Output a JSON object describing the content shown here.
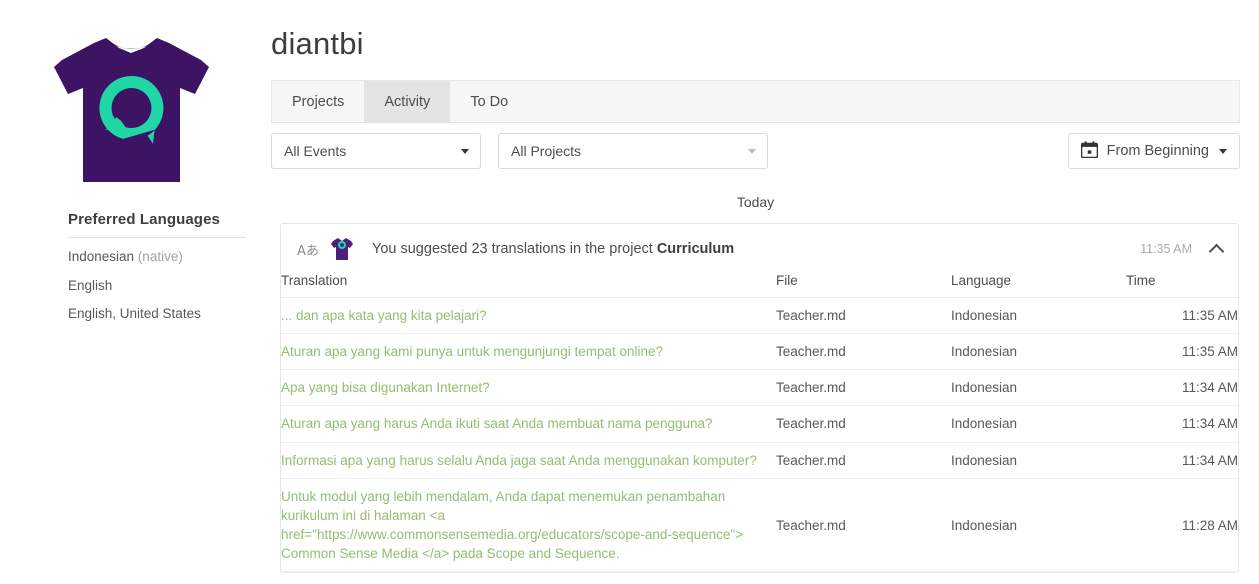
{
  "colors": {
    "shirt_purple": "#3d1464",
    "shirt_logo_teal": "#21d6a6",
    "link_green": "#93bd73",
    "tab_active_bg": "#e4e4e4",
    "tabbar_bg": "#f7f7f7"
  },
  "sidebar": {
    "avatar_name": "tshirt-avatar",
    "preferred_languages_title": "Preferred Languages",
    "languages": [
      {
        "name": "Indonesian",
        "note": " (native)"
      },
      {
        "name": "English",
        "note": ""
      },
      {
        "name": "English, United States",
        "note": ""
      }
    ]
  },
  "header": {
    "title": "diantbi"
  },
  "tabs": [
    {
      "label": "Projects",
      "active": false
    },
    {
      "label": "Activity",
      "active": true
    },
    {
      "label": "To Do",
      "active": false
    }
  ],
  "filters": {
    "events_select": {
      "value": "All Events"
    },
    "projects_select": {
      "value": "All Projects"
    },
    "date_button": {
      "label": "From Beginning",
      "icon": "calendar-icon"
    }
  },
  "timeline": {
    "day_divider": "Today",
    "entry": {
      "lang_icon": "Aあ",
      "avatar_icon": "tshirt-icon",
      "text_before": "You suggested 23 translations in the project ",
      "project_name": "Curriculum",
      "time": "11:35 AM",
      "collapse_icon": "chevron-up-icon",
      "columns": [
        "Translation",
        "File",
        "Language",
        "Time"
      ],
      "rows": [
        {
          "translation": "... dan apa kata yang kita pelajari?",
          "file": "Teacher.md",
          "language": "Indonesian",
          "time": "11:35 AM"
        },
        {
          "translation": "Aturan apa yang kami punya untuk mengunjungi tempat online?",
          "file": "Teacher.md",
          "language": "Indonesian",
          "time": "11:35 AM"
        },
        {
          "translation": "Apa yang bisa digunakan Internet?",
          "file": "Teacher.md",
          "language": "Indonesian",
          "time": "11:34 AM"
        },
        {
          "translation": "Aturan apa yang harus Anda ikuti saat Anda membuat nama pengguna?",
          "file": "Teacher.md",
          "language": "Indonesian",
          "time": "11:34 AM"
        },
        {
          "translation": "Informasi apa yang harus selalu Anda jaga saat Anda menggunakan komputer?",
          "file": "Teacher.md",
          "language": "Indonesian",
          "time": "11:34 AM"
        },
        {
          "translation": "Untuk modul yang lebih mendalam, Anda dapat menemukan penambahan kurikulum ini di halaman <a href=\"https://www.commonsensemedia.org/educators/scope-and-sequence\"> Common Sense Media </a> pada Scope and Sequence.",
          "file": "Teacher.md",
          "language": "Indonesian",
          "time": "11:28 AM"
        }
      ]
    }
  }
}
